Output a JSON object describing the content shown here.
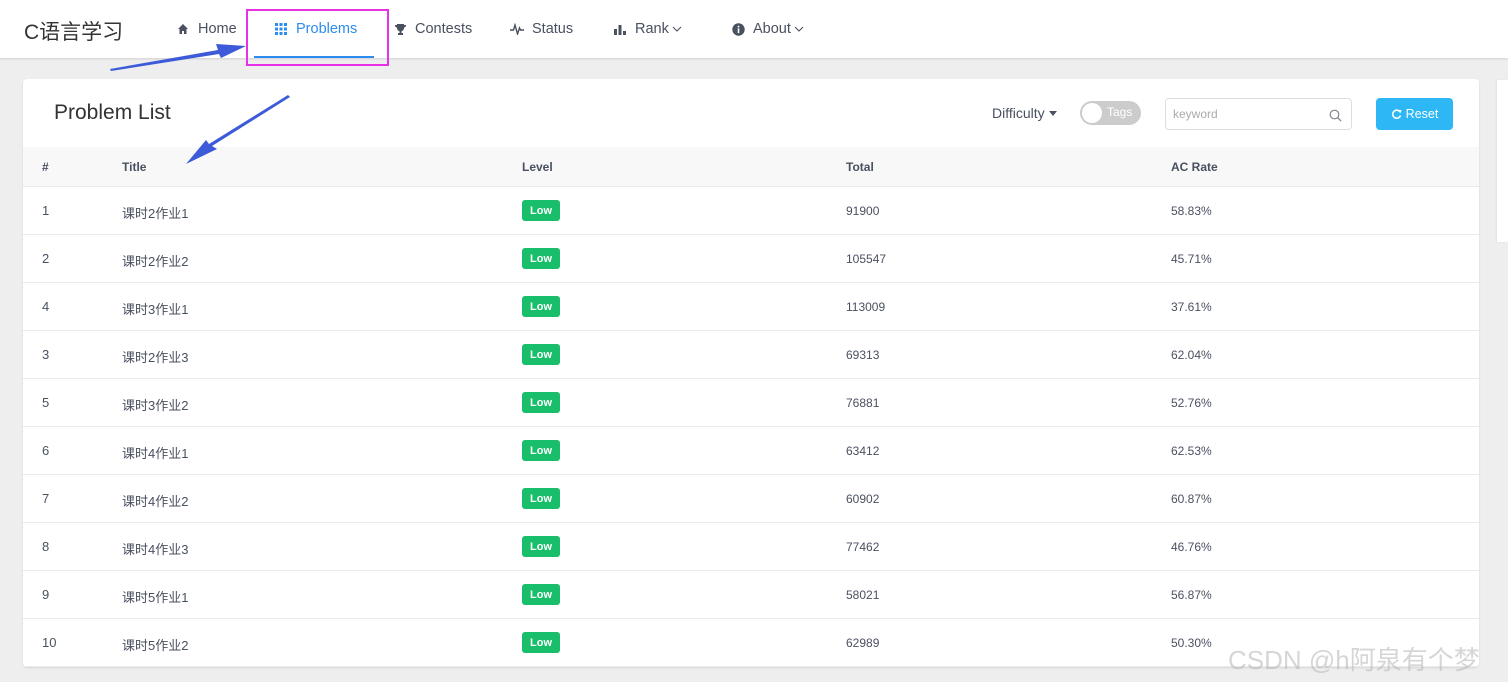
{
  "app": {
    "logo": "C语言学习"
  },
  "nav": {
    "items": [
      {
        "label": "Home",
        "icon": "home-icon"
      },
      {
        "label": "Problems",
        "icon": "grid-icon",
        "active": true
      },
      {
        "label": "Contests",
        "icon": "trophy-icon"
      },
      {
        "label": "Status",
        "icon": "pulse-icon"
      },
      {
        "label": "Rank",
        "icon": "bar-chart-icon",
        "dropdown": true
      },
      {
        "label": "About",
        "icon": "info-icon",
        "dropdown": true
      }
    ]
  },
  "panel": {
    "title": "Problem List",
    "difficulty_label": "Difficulty",
    "tags_toggle_label": "Tags",
    "search": {
      "placeholder": "keyword",
      "value": ""
    },
    "reset_label": "Reset"
  },
  "table": {
    "headers": [
      "#",
      "Title",
      "Level",
      "Total",
      "AC Rate"
    ],
    "rows": [
      {
        "id": "1",
        "title": "课时2作业1",
        "level": "Low",
        "total": "91900",
        "ac_rate": "58.83%"
      },
      {
        "id": "2",
        "title": "课时2作业2",
        "level": "Low",
        "total": "105547",
        "ac_rate": "45.71%"
      },
      {
        "id": "4",
        "title": "课时3作业1",
        "level": "Low",
        "total": "113009",
        "ac_rate": "37.61%"
      },
      {
        "id": "3",
        "title": "课时2作业3",
        "level": "Low",
        "total": "69313",
        "ac_rate": "62.04%"
      },
      {
        "id": "5",
        "title": "课时3作业2",
        "level": "Low",
        "total": "76881",
        "ac_rate": "52.76%"
      },
      {
        "id": "6",
        "title": "课时4作业1",
        "level": "Low",
        "total": "63412",
        "ac_rate": "62.53%"
      },
      {
        "id": "7",
        "title": "课时4作业2",
        "level": "Low",
        "total": "60902",
        "ac_rate": "60.87%"
      },
      {
        "id": "8",
        "title": "课时4作业3",
        "level": "Low",
        "total": "77462",
        "ac_rate": "46.76%"
      },
      {
        "id": "9",
        "title": "课时5作业1",
        "level": "Low",
        "total": "58021",
        "ac_rate": "56.87%"
      },
      {
        "id": "10",
        "title": "课时5作业2",
        "level": "Low",
        "total": "62989",
        "ac_rate": "50.30%"
      }
    ]
  },
  "colors": {
    "accent": "#2d8cf0",
    "level_low": "#19be6b",
    "reset_button": "#2db7f5",
    "highlight_box": "#e631e6",
    "annotation_arrow": "#3d5bd9"
  },
  "watermark": "CSDN @h阿泉有个梦"
}
